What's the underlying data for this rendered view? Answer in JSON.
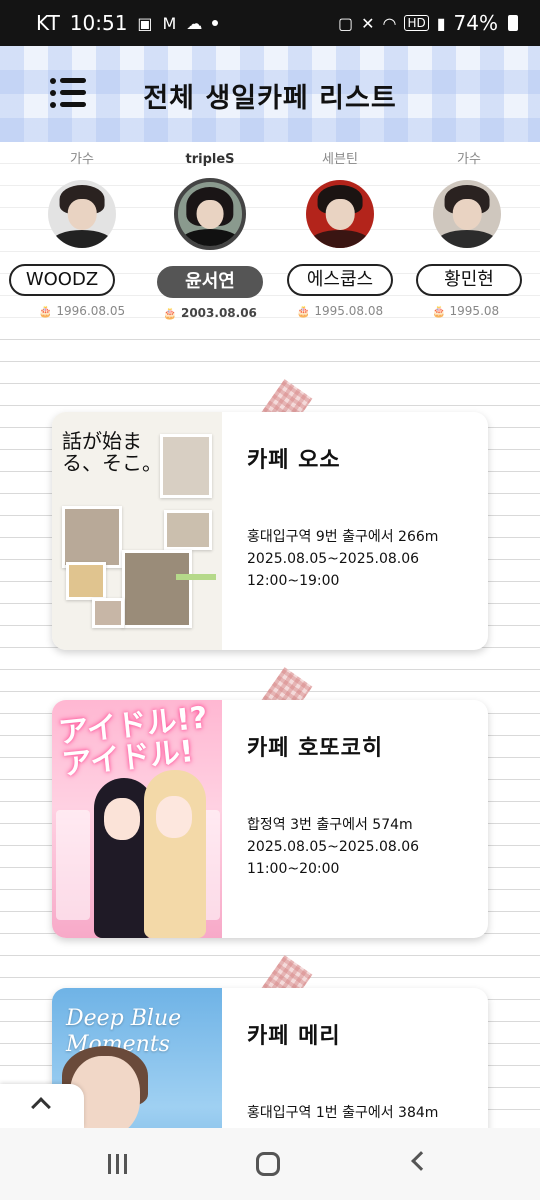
{
  "status_bar": {
    "carrier": "KT",
    "time": "10:51",
    "hd": "HD",
    "battery": "74%"
  },
  "header": {
    "title": "전체 생일카페 리스트"
  },
  "artists": [
    {
      "group": "가수",
      "name": "WOODZ",
      "birthday": "1996.08.05",
      "selected": false
    },
    {
      "group": "tripleS",
      "name": "윤서연",
      "birthday": "2003.08.06",
      "selected": true
    },
    {
      "group": "세븐틴",
      "name": "에스쿱스",
      "birthday": "1995.08.08",
      "selected": false
    },
    {
      "group": "가수",
      "name": "황민현",
      "birthday": "1995.08",
      "selected": false
    }
  ],
  "cafes": [
    {
      "name": "카페 오소",
      "location": "홍대입구역 9번 출구에서 266m",
      "dates": "2025.08.05~2025.08.06",
      "hours": "12:00~19:00",
      "poster_text": "話が始まる、そこ。"
    },
    {
      "name": "카페 호또코히",
      "location": "합정역 3번 출구에서 574m",
      "dates": "2025.08.05~2025.08.06",
      "hours": "11:00~20:00",
      "poster_text": "アイドル!? アイドル!"
    },
    {
      "name": "카페 메리",
      "location": "홍대입구역 1번 출구에서 384m",
      "poster_text": "Deep Blue Moments"
    }
  ],
  "icons": {
    "menu": "hamburger-icon",
    "scroll_top": "chevron-up-icon",
    "cake": "cake-icon"
  }
}
